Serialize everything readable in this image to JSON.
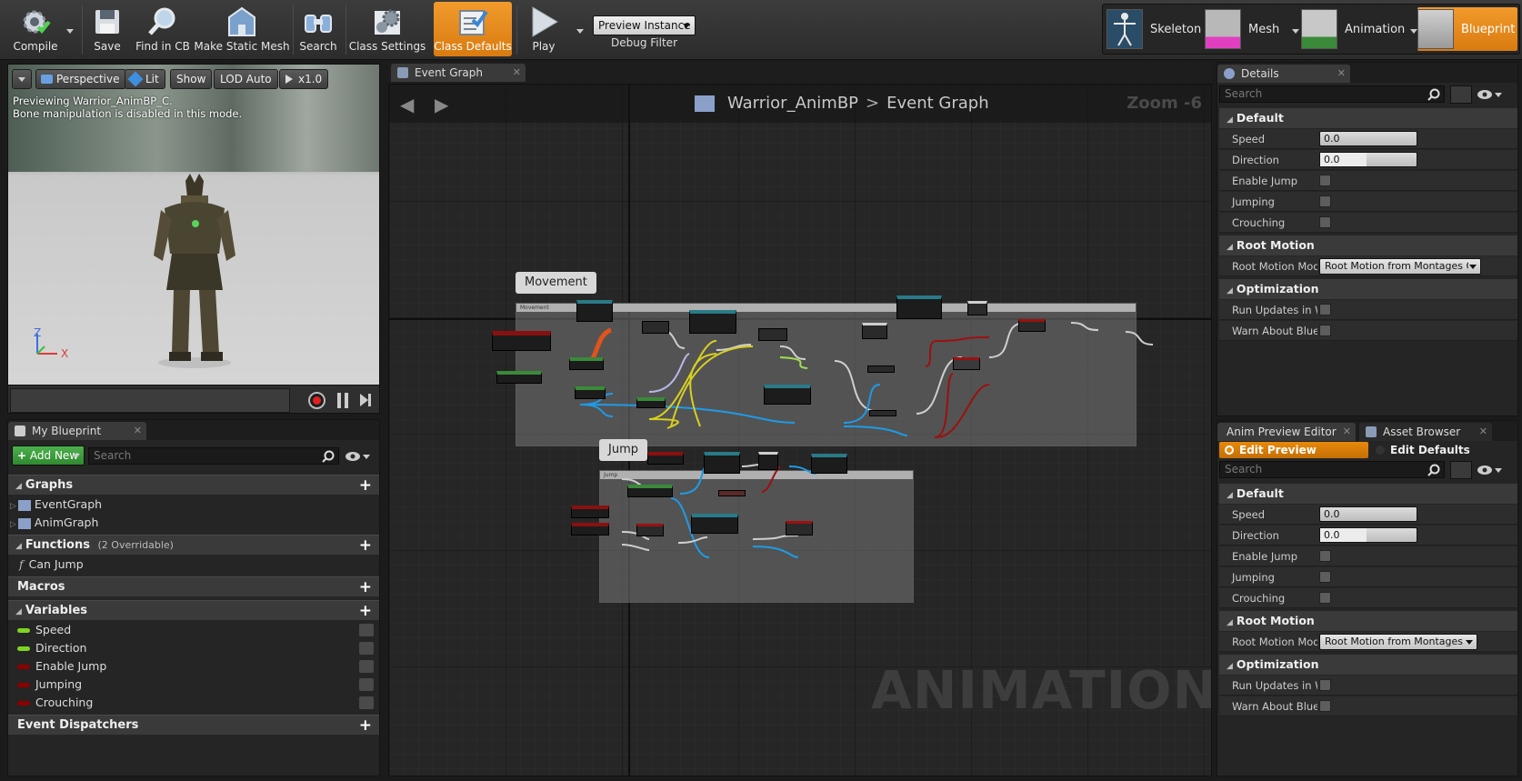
{
  "toolbar": {
    "compile": "Compile",
    "save": "Save",
    "find_in_cb": "Find in CB",
    "make_static_mesh": "Make Static Mesh",
    "search": "Search",
    "class_settings": "Class Settings",
    "class_defaults": "Class Defaults",
    "play": "Play",
    "debug_dropdown": "Preview Instance",
    "debug_filter": "Debug Filter"
  },
  "modes": {
    "skeleton": "Skeleton",
    "mesh": "Mesh",
    "animation": "Animation",
    "blueprint": "Blueprint"
  },
  "viewport": {
    "perspective": "Perspective",
    "lit": "Lit",
    "show": "Show",
    "lod": "LOD Auto",
    "speed": "x1.0",
    "info_line1": "Previewing Warrior_AnimBP_C.",
    "info_line2": "Bone manipulation is disabled in this mode.",
    "axis_z": "Z",
    "axis_x": "X"
  },
  "my_blueprint": {
    "tab": "My Blueprint",
    "add_new": "Add New",
    "search_placeholder": "Search",
    "graphs": "Graphs",
    "graph_items": [
      "EventGraph",
      "AnimGraph"
    ],
    "functions": "Functions",
    "functions_note": "(2 Overridable)",
    "function_items": [
      "Can Jump"
    ],
    "macros": "Macros",
    "variables": "Variables",
    "variable_items": [
      {
        "name": "Speed",
        "color": "#7ed321"
      },
      {
        "name": "Direction",
        "color": "#7ed321"
      },
      {
        "name": "Enable Jump",
        "color": "#8b0000"
      },
      {
        "name": "Jumping",
        "color": "#8b0000"
      },
      {
        "name": "Crouching",
        "color": "#8b0000"
      }
    ],
    "event_dispatchers": "Event Dispatchers"
  },
  "graph": {
    "tab": "Event Graph",
    "crumb_root": "Warrior_AnimBP",
    "crumb_sep": ">",
    "crumb_current": "Event Graph",
    "zoom": "Zoom -6",
    "comment_movement": "Movement",
    "comment_movement_small": "Movement",
    "comment_jump": "Jump",
    "comment_jump_small": "Jump",
    "watermark": "ANIMATION"
  },
  "details": {
    "tab": "Details",
    "search_placeholder": "Search",
    "default": "Default",
    "speed_label": "Speed",
    "speed_value": "0.0",
    "direction_label": "Direction",
    "direction_value": "0.0",
    "enable_jump": "Enable Jump",
    "jumping": "Jumping",
    "crouching": "Crouching",
    "root_motion": "Root Motion",
    "root_motion_mode": "Root Motion Mode",
    "root_motion_value": "Root Motion from Montages Only",
    "optimization": "Optimization",
    "run_updates": "Run Updates in Worker Thread",
    "warn_about": "Warn About Blueprint Usage"
  },
  "anim_preview": {
    "tab1": "Anim Preview Editor",
    "tab2": "Asset Browser",
    "edit_preview": "Edit Preview",
    "edit_defaults": "Edit Defaults",
    "search_placeholder": "Search"
  },
  "colors": {
    "accent": "#e8890c",
    "panel": "#252525",
    "exec_white": "#e0e0e0",
    "float_green": "#a0e050",
    "bool_red": "#9b1111",
    "object_blue": "#1e9be8"
  }
}
